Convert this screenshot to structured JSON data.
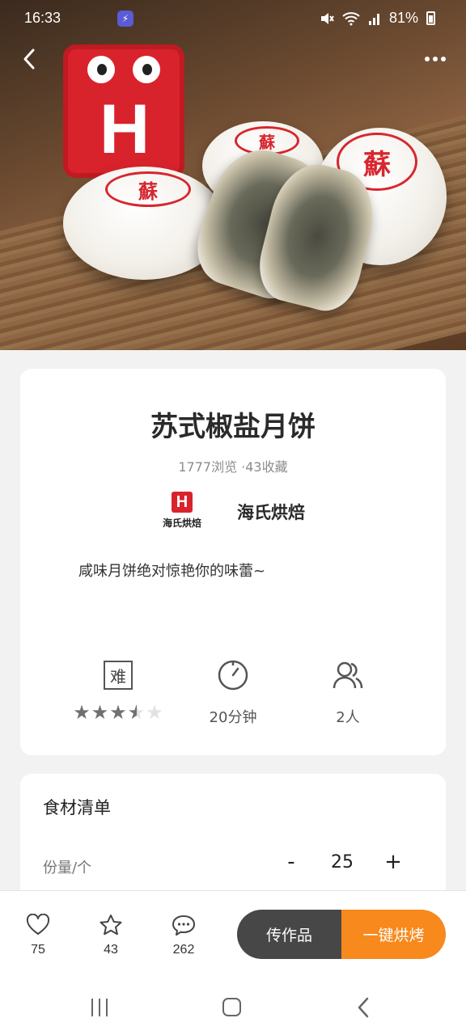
{
  "status_bar": {
    "time": "16:33",
    "battery": "81%",
    "icons": [
      "shield-icon",
      "mute-icon",
      "wifi-icon",
      "signal-icon",
      "battery-icon"
    ]
  },
  "header": {
    "back_icon": "chevron-left-icon",
    "more_icon": "more-dots-icon"
  },
  "hero": {
    "mascot_letter": "H",
    "stamp_text": "蘇"
  },
  "recipe": {
    "title": "苏式椒盐月饼",
    "stats": "1777浏览 ·43收藏",
    "author": {
      "logo_letter": "H",
      "logo_text": "海氏烘焙",
      "name": "海氏烘焙"
    },
    "description": "咸味月饼绝对惊艳你的味蕾~",
    "difficulty": {
      "badge": "难",
      "rating": 3.5,
      "max": 5
    },
    "time": "20分钟",
    "servings": "2人"
  },
  "ingredients": {
    "title": "食材清单",
    "serving_label": "份量/个",
    "minus": "-",
    "quantity": "25",
    "plus": "+"
  },
  "action_bar": {
    "likes": "75",
    "favorites": "43",
    "comments": "262",
    "upload_label": "传作品",
    "bake_label": "一键烘烤"
  },
  "colors": {
    "accent": "#f7891d",
    "dark_button": "#474747",
    "brand_red": "#d9232c"
  }
}
